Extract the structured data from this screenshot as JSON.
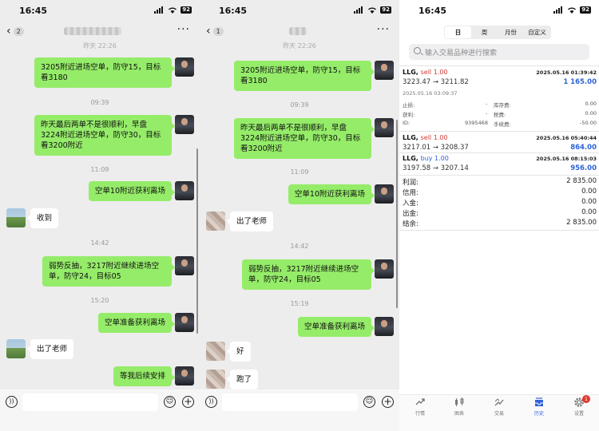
{
  "status_bar": {
    "time": "16:45",
    "battery": "92"
  },
  "chat1": {
    "back_badge": "2",
    "first_time_partial": "昨天 22:26",
    "items": [
      {
        "type": "out",
        "text": "3205附近进场空单，防守15，目标看3180"
      },
      {
        "type": "time",
        "text": "09:39"
      },
      {
        "type": "out",
        "text": "昨天最后两单不是很顺利，早盘3224附近进场空单，防守30，目标看3200附近"
      },
      {
        "type": "time",
        "text": "11:09"
      },
      {
        "type": "out",
        "text": "空单10附近获利离场"
      },
      {
        "type": "in",
        "text": "收到"
      },
      {
        "type": "time",
        "text": "14:42"
      },
      {
        "type": "out",
        "text": "弱势反抽，3217附近继续进场空单，防守24，目标05"
      },
      {
        "type": "time",
        "text": "15:20"
      },
      {
        "type": "out",
        "text": "空单准备获利离场"
      },
      {
        "type": "in",
        "text": "出了老师"
      },
      {
        "type": "out",
        "text": "等我后续安排"
      }
    ]
  },
  "chat2": {
    "back_badge": "1",
    "first_time_partial": "昨天 22:26",
    "items": [
      {
        "type": "out",
        "text": "3205附近进场空单，防守15，目标看3180"
      },
      {
        "type": "time",
        "text": "09:39"
      },
      {
        "type": "out",
        "text": "昨天最后两单不是很顺利，早盘3224附近进场空单，防守30，目标看3200附近"
      },
      {
        "type": "time",
        "text": "11:09"
      },
      {
        "type": "out",
        "text": "空单10附近获利离场"
      },
      {
        "type": "in",
        "text": "出了老师"
      },
      {
        "type": "time",
        "text": "14:42"
      },
      {
        "type": "out",
        "text": "弱势反抽，3217附近继续进场空单，防守24，目标05"
      },
      {
        "type": "time",
        "text": "15:19"
      },
      {
        "type": "out",
        "text": "空单准备获利离场"
      },
      {
        "type": "in",
        "text": "好"
      },
      {
        "type": "in",
        "text": "跑了"
      }
    ]
  },
  "trading": {
    "tabs": [
      "日",
      "周",
      "月份",
      "自定义"
    ],
    "active_tab": "日",
    "search_placeholder": "输入交易品种进行搜索",
    "deals": [
      {
        "symbol": "LLG,",
        "side": "sell 1.00",
        "side_type": "sell",
        "time": "2025.05.16 01:39:42",
        "prices": "3223.47 → 3211.82",
        "profit": "1 165.00",
        "open_time": "2025.05.16 03:09:37",
        "details": {
          "stop_loss_label": "止损:",
          "stop_loss_value": "-",
          "take_profit_label": "获利:",
          "take_profit_value": "-",
          "id_label": "ID:",
          "id_value": "9395468",
          "swap_label": "库存费:",
          "swap_value": "0.00",
          "tax_label": "税费:",
          "tax_value": "0.00",
          "commission_label": "手续费:",
          "commission_value": "-50.00"
        }
      },
      {
        "symbol": "LLG,",
        "side": "sell 1.00",
        "side_type": "sell",
        "time": "2025.05.16 05:40:44",
        "prices": "3217.01 → 3208.37",
        "profit": "864.00"
      },
      {
        "symbol": "LLG,",
        "side": "buy 1.00",
        "side_type": "buy",
        "time": "2025.05.16 08:15:03",
        "prices": "3197.58 → 3207.14",
        "profit": "956.00"
      }
    ],
    "summary": [
      {
        "label": "利润:",
        "value": "2 835.00"
      },
      {
        "label": "信用:",
        "value": "0.00"
      },
      {
        "label": "入金:",
        "value": "0.00"
      },
      {
        "label": "出金:",
        "value": "0.00"
      },
      {
        "label": "结余:",
        "value": "2 835.00"
      }
    ],
    "bottom_nav": [
      {
        "label": "行情",
        "icon": "quotes-icon"
      },
      {
        "label": "图表",
        "icon": "chart-icon"
      },
      {
        "label": "交易",
        "icon": "trade-icon"
      },
      {
        "label": "历史",
        "icon": "history-icon",
        "active": true
      },
      {
        "label": "设置",
        "icon": "settings-icon",
        "badge": "1"
      }
    ],
    "colors": {
      "sell": "#d23b36",
      "buy": "#2e62d9",
      "accent": "#2e62d9",
      "wechat_green": "#95ec69"
    }
  }
}
